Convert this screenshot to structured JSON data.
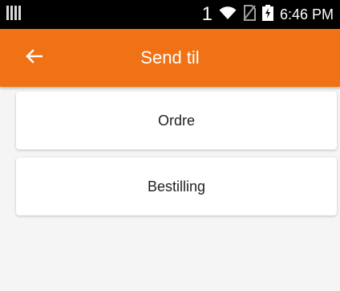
{
  "status_bar": {
    "sim_number": "1",
    "time": "6:46 PM",
    "icons": [
      "barcode-icon",
      "wifi-icon",
      "no-sim-icon",
      "battery-charging-icon"
    ]
  },
  "app_bar": {
    "title": "Send til",
    "back_icon": "arrow-back-icon",
    "color": "#f07214"
  },
  "options": [
    {
      "label": "Ordre"
    },
    {
      "label": "Bestilling"
    }
  ]
}
